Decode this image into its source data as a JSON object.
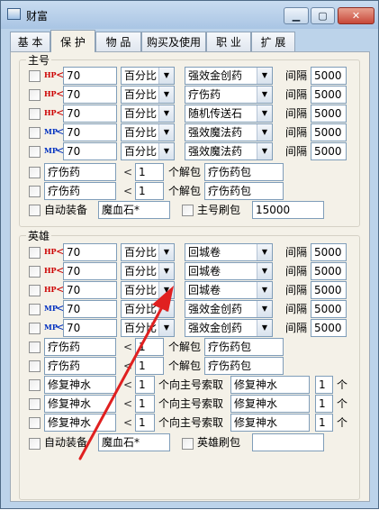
{
  "window": {
    "title": "财富"
  },
  "tabs": [
    {
      "label": "基 本"
    },
    {
      "label": "保 护"
    },
    {
      "label": "物 品"
    },
    {
      "label": "购买及使用"
    },
    {
      "label": "职 业"
    },
    {
      "label": "扩 展"
    }
  ],
  "common": {
    "hp_tag": "HP",
    "mp_tag": "MP",
    "lt": "<",
    "interval": "间隔",
    "unit_ge": "个",
    "jiebao": "个解包",
    "suoqu": "个向主号索取"
  },
  "main": {
    "group_label": "主号",
    "rows": [
      {
        "tag": "HP",
        "threshold": "70",
        "mode": "百分比",
        "item": "强效金创药",
        "interval": "5000"
      },
      {
        "tag": "HP",
        "threshold": "70",
        "mode": "百分比",
        "item": "疗伤药",
        "interval": "5000"
      },
      {
        "tag": "HP",
        "threshold": "70",
        "mode": "百分比",
        "item": "随机传送石",
        "interval": "5000"
      },
      {
        "tag": "MP",
        "threshold": "70",
        "mode": "百分比",
        "item": "强效魔法药",
        "interval": "5000"
      },
      {
        "tag": "MP",
        "threshold": "70",
        "mode": "百分比",
        "item": "强效魔法药",
        "interval": "5000"
      }
    ],
    "unpack": [
      {
        "item": "疗伤药",
        "count": "1",
        "package": "疗伤药包"
      },
      {
        "item": "疗伤药",
        "count": "1",
        "package": "疗伤药包"
      }
    ],
    "auto_equip_label": "自动装备",
    "auto_equip_value": "魔血石*",
    "refresh_label": "主号刷包",
    "refresh_value": "15000"
  },
  "hero": {
    "group_label": "英雄",
    "rows": [
      {
        "tag": "HP",
        "threshold": "70",
        "mode": "百分比",
        "item": "回城卷",
        "interval": "5000"
      },
      {
        "tag": "HP",
        "threshold": "70",
        "mode": "百分比",
        "item": "回城卷",
        "interval": "5000"
      },
      {
        "tag": "HP",
        "threshold": "70",
        "mode": "百分比",
        "item": "回城卷",
        "interval": "5000"
      },
      {
        "tag": "MP",
        "threshold": "70",
        "mode": "百分比",
        "item": "强效金创药",
        "interval": "5000"
      },
      {
        "tag": "MP",
        "threshold": "70",
        "mode": "百分比",
        "item": "强效金创药",
        "interval": "5000"
      }
    ],
    "unpack": [
      {
        "item": "疗伤药",
        "count": "1",
        "package": "疗伤药包"
      },
      {
        "item": "疗伤药",
        "count": "1",
        "package": "疗伤药包"
      }
    ],
    "request": [
      {
        "item": "修复神水",
        "count": "1",
        "target": "修复神水",
        "amount": "1"
      },
      {
        "item": "修复神水",
        "count": "1",
        "target": "修复神水",
        "amount": "1"
      },
      {
        "item": "修复神水",
        "count": "1",
        "target": "修复神水",
        "amount": "1"
      }
    ],
    "auto_equip_label": "自动装备",
    "auto_equip_value": "魔血石*",
    "refresh_label": "英雄刷包",
    "refresh_value": ""
  },
  "colors": {
    "hp": "#cc0000",
    "mp": "#0030c0",
    "arrow": "#e02020"
  }
}
